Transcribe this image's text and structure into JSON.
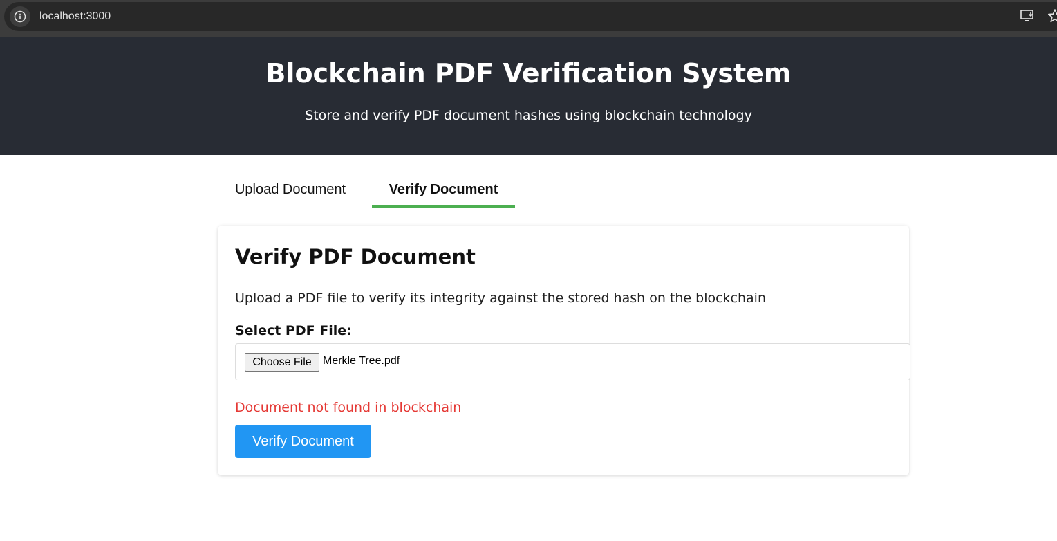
{
  "browser": {
    "url": "localhost:3000",
    "icons": [
      "info-icon",
      "install-app-icon",
      "bookmark-star-icon"
    ]
  },
  "header": {
    "title": "Blockchain PDF Verification System",
    "subtitle": "Store and verify PDF document hashes using blockchain technology",
    "background": "#282c34"
  },
  "tabs": [
    {
      "label": "Upload Document",
      "active": false
    },
    {
      "label": "Verify Document",
      "active": true
    }
  ],
  "verify": {
    "title": "Verify PDF Document",
    "description": "Upload a PDF file to verify its integrity against the stored hash on the blockchain",
    "file_label": "Select PDF File:",
    "choose_file_label": "Choose File",
    "file_name": "Merkle Tree.pdf",
    "error_message": "Document not found in blockchain",
    "button_label": "Verify Document"
  },
  "colors": {
    "accent_tab": "#4caf50",
    "button": "#2196f3",
    "error": "#e53935"
  }
}
